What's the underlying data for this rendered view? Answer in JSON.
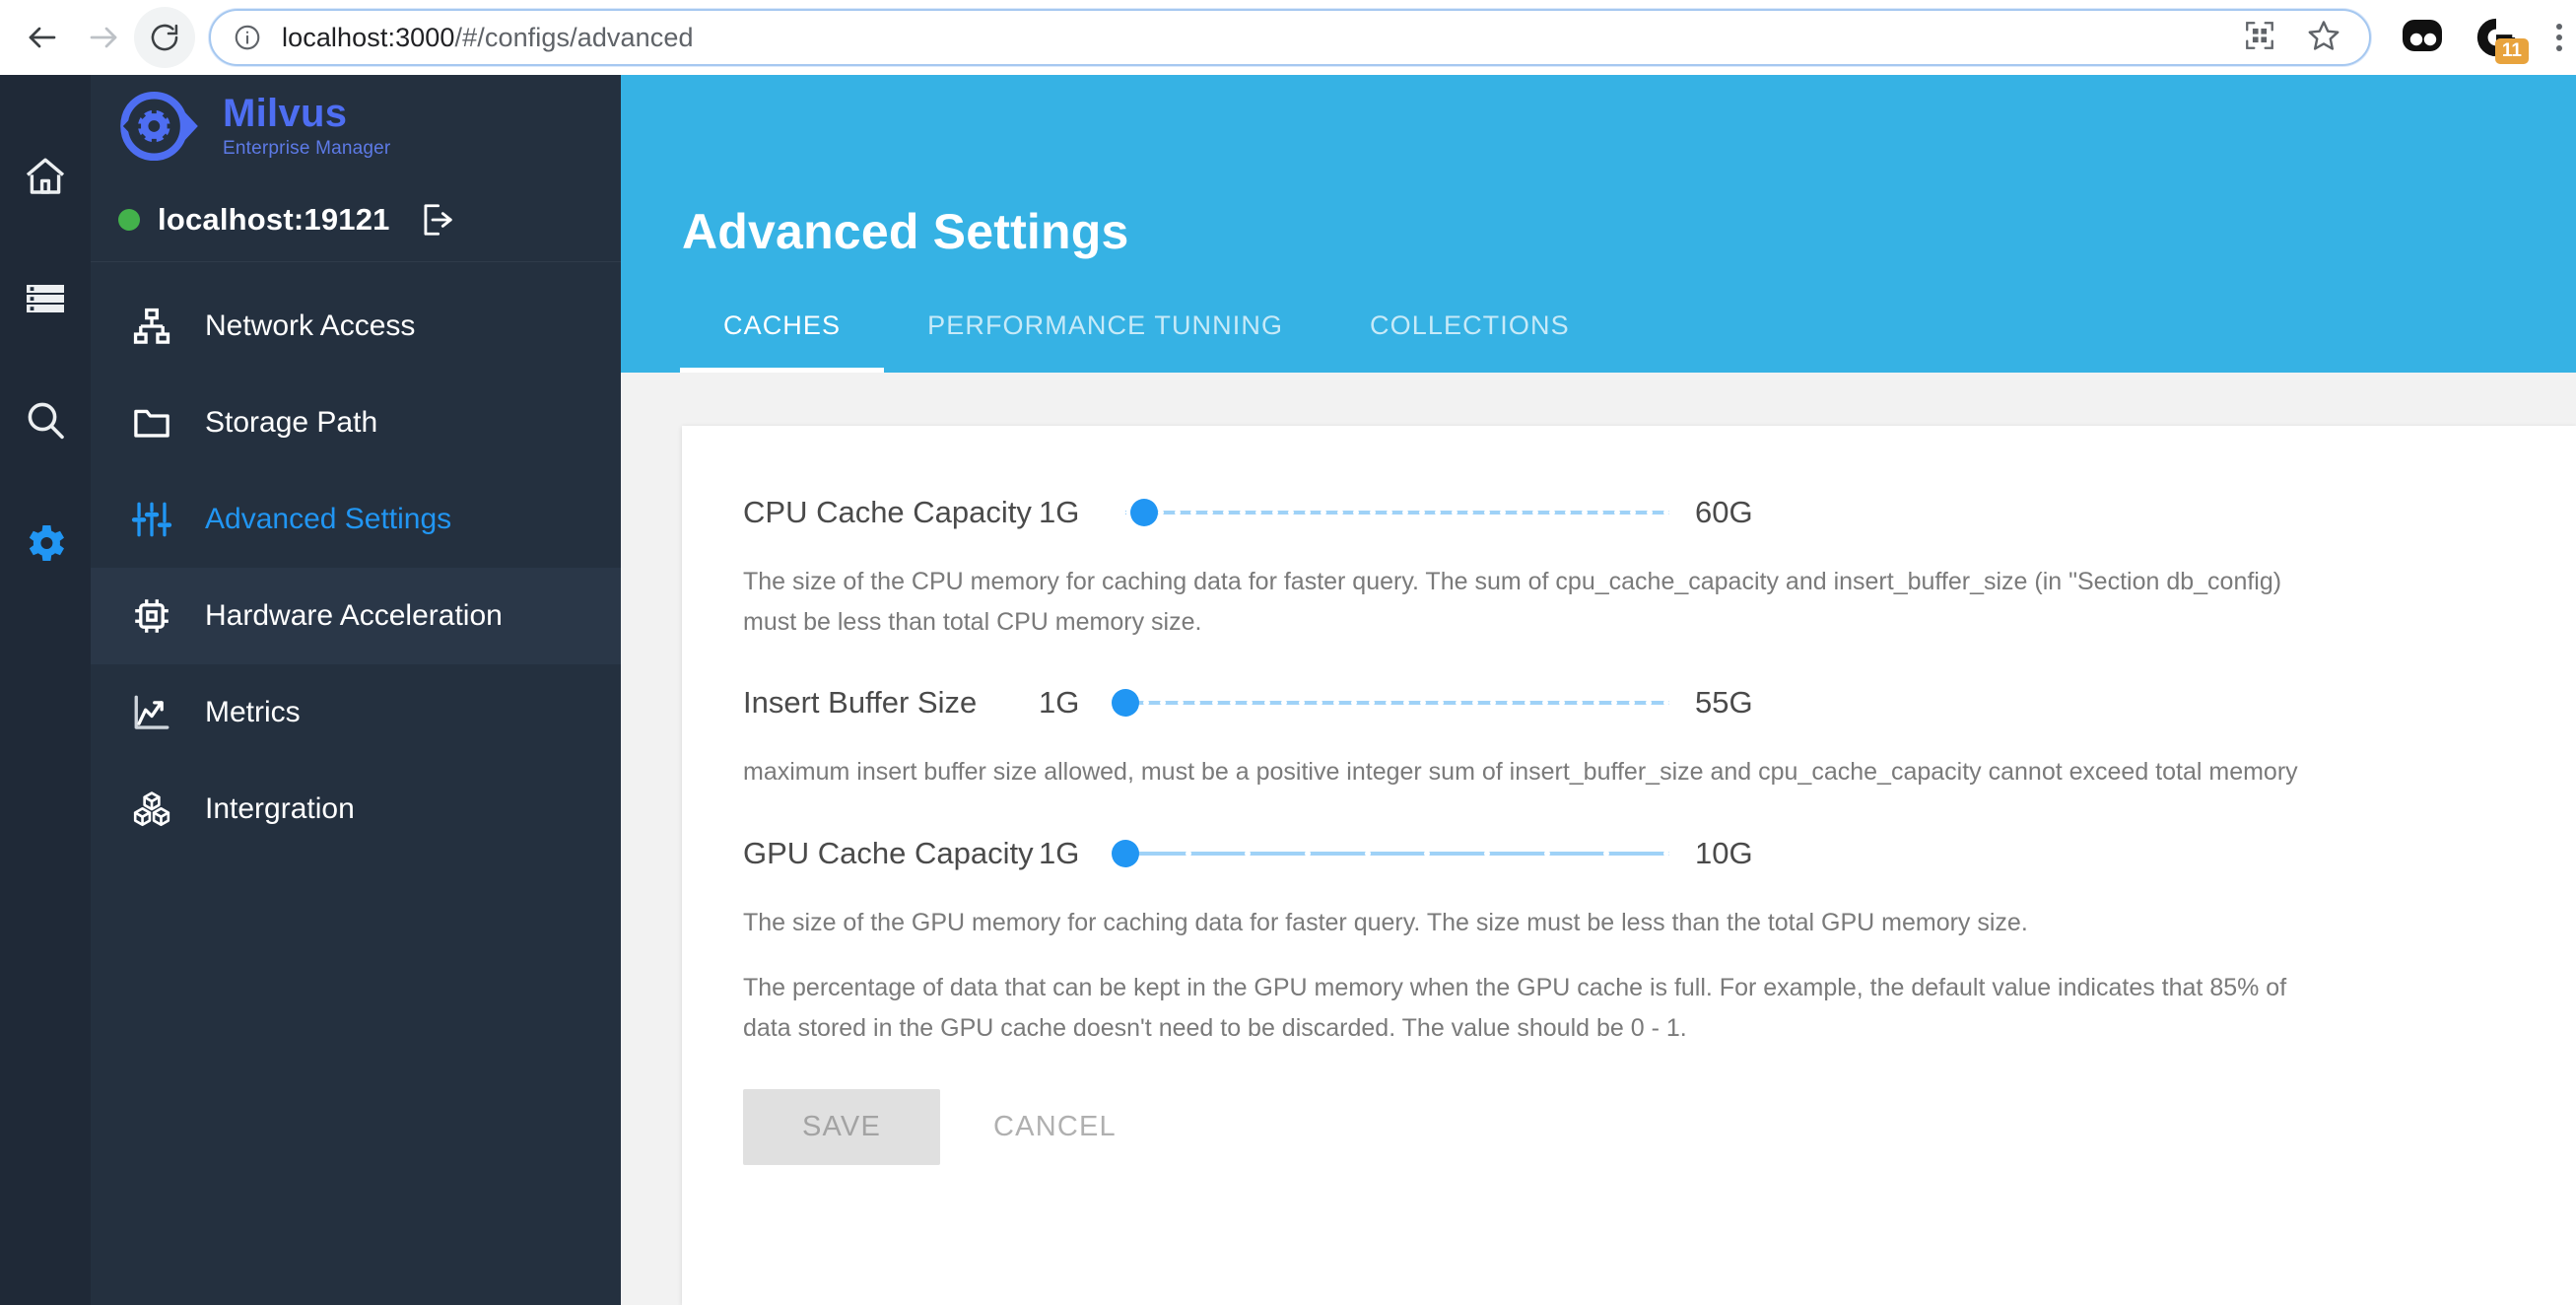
{
  "browser": {
    "url_prefix": "localhost:3000",
    "url_suffix": "/#/configs/advanced",
    "back_icon": "back-arrow-icon",
    "forward_icon": "forward-arrow-icon",
    "reload_icon": "reload-icon",
    "info_icon": "site-info-icon",
    "qr_icon": "qr-code-icon",
    "bookmark_icon": "star-bookmark-icon",
    "extension_badge": "11"
  },
  "rail": {
    "items": [
      {
        "name": "home-icon",
        "label": "Home"
      },
      {
        "name": "database-icon",
        "label": "Databases"
      },
      {
        "name": "search-icon",
        "label": "Search"
      },
      {
        "name": "gear-icon",
        "label": "Settings",
        "active": true
      }
    ]
  },
  "sidebar": {
    "brand": {
      "name": "Milvus",
      "subtitle": "Enterprise Manager"
    },
    "host": {
      "name": "localhost:19121",
      "status": "connected"
    },
    "items": [
      {
        "label": "Network Access",
        "icon": "sitemap-icon",
        "state": "normal"
      },
      {
        "label": "Storage Path",
        "icon": "folder-icon",
        "state": "normal"
      },
      {
        "label": "Advanced Settings",
        "icon": "tune-sliders-icon",
        "state": "active"
      },
      {
        "label": "Hardware Acceleration",
        "icon": "chip-icon",
        "state": "hover"
      },
      {
        "label": "Metrics",
        "icon": "line-chart-icon",
        "state": "normal"
      },
      {
        "label": "Intergration",
        "icon": "cubes-icon",
        "state": "normal"
      }
    ]
  },
  "page": {
    "title": "Advanced Settings",
    "tabs": [
      {
        "label": "CACHES",
        "active": true
      },
      {
        "label": "PERFORMANCE TUNNING",
        "active": false
      },
      {
        "label": "COLLECTIONS",
        "active": false
      }
    ]
  },
  "settings": [
    {
      "label": "CPU Cache Capacity",
      "min_label": "1G",
      "max_label": "60G",
      "min": 1,
      "max": 60,
      "value": 3,
      "marks": 34,
      "description": "The size of the CPU memory for caching data for faster query. The sum of cpu_cache_capacity and insert_buffer_size (in \"Section db_config) must be less than total CPU memory size."
    },
    {
      "label": "Insert Buffer Size",
      "min_label": "1G",
      "max_label": "55G",
      "min": 1,
      "max": 55,
      "value": 1,
      "marks": 32,
      "description": "maximum insert buffer size allowed, must be a positive integer sum of insert_buffer_size and cpu_cache_capacity cannot exceed total memory"
    },
    {
      "label": "GPU Cache Capacity",
      "min_label": "1G",
      "max_label": "10G",
      "min": 1,
      "max": 10,
      "value": 1,
      "marks": 10,
      "description": "The size of the GPU memory for caching data for faster query. The size must be less than the total GPU memory size.",
      "description2": "The percentage of data that can be kept in the GPU memory when the GPU cache is full. For example, the default value indicates that 85% of data stored in the GPU cache doesn't need to be discarded. The value should be 0 - 1."
    }
  ],
  "actions": {
    "save_label": "SAVE",
    "cancel_label": "CANCEL",
    "save_disabled": true
  },
  "colors": {
    "hero": "#36b2e4",
    "accent": "#2196f3",
    "brand": "#4e6ef2",
    "sidebar": "#24303f",
    "rail": "#1f2937",
    "status_online": "#43b14b"
  }
}
